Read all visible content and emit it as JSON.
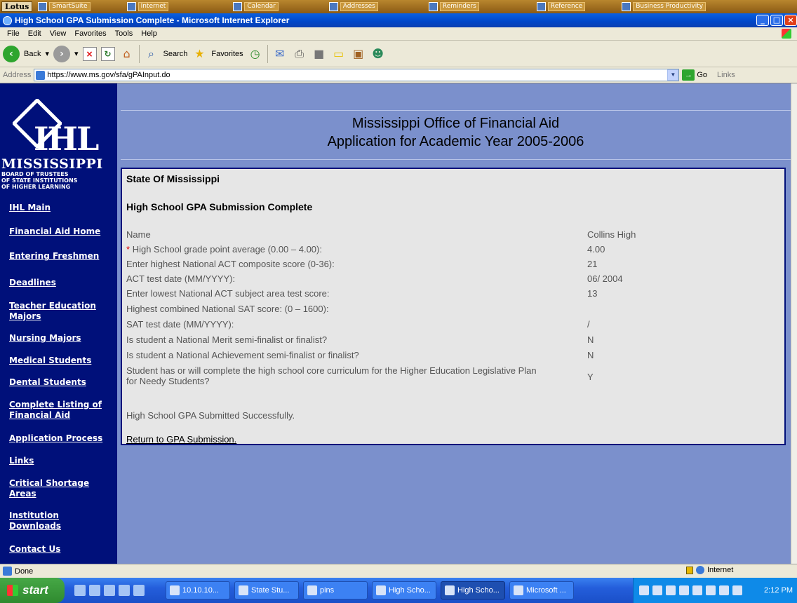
{
  "lotus": {
    "brand": "Lotus",
    "items": [
      {
        "label": "SmartSuite",
        "icon": "smartsuite-icon"
      },
      {
        "label": "Internet",
        "icon": "internet-icon"
      },
      {
        "label": "Calendar",
        "icon": "calendar-icon"
      },
      {
        "label": "Addresses",
        "icon": "addresses-icon"
      },
      {
        "label": "Reminders",
        "icon": "reminders-icon"
      },
      {
        "label": "Reference",
        "icon": "reference-icon"
      },
      {
        "label": "Business Productivity",
        "icon": "business-icon"
      }
    ]
  },
  "window": {
    "title": "High School GPA Submission Complete - Microsoft Internet Explorer"
  },
  "menu": {
    "items": [
      "File",
      "Edit",
      "View",
      "Favorites",
      "Tools",
      "Help"
    ]
  },
  "toolbar": {
    "back_label": "Back",
    "search_label": "Search",
    "favorites_label": "Favorites"
  },
  "address": {
    "label": "Address",
    "url": "https://www.ms.gov/sfa/gPAInput.do",
    "go_label": "Go",
    "links_label": "Links"
  },
  "sidebar": {
    "logo_text": "IHL",
    "logo_ms": "MISSISSIPPI",
    "logo_sub": [
      "BOARD OF TRUSTEES",
      "OF STATE INSTITUTIONS",
      "OF HIGHER LEARNING"
    ],
    "items": [
      {
        "label": "IHL Main"
      },
      {
        "label": "Financial Aid Home"
      },
      {
        "label": "Entering Freshmen"
      },
      {
        "label": "Deadlines"
      },
      {
        "label": "Teacher Education Majors"
      },
      {
        "label": "Nursing Majors"
      },
      {
        "label": "Medical Students"
      },
      {
        "label": "Dental Students"
      },
      {
        "label": "Complete Listing of Financial Aid"
      },
      {
        "label": "Application Process"
      },
      {
        "label": "Links"
      },
      {
        "label": "Critical Shortage Areas"
      },
      {
        "label": "Institution Downloads"
      },
      {
        "label": "Contact Us"
      }
    ]
  },
  "header": {
    "title": "Mississippi Office of Financial Aid",
    "subtitle": "Application for Academic Year 2005-2006"
  },
  "content": {
    "state": "State Of Mississippi",
    "section_title": "High School GPA Submission Complete",
    "rows": [
      {
        "label": "Name",
        "value": "Collins High",
        "required": false
      },
      {
        "label": "High School grade point average (0.00 – 4.00):",
        "value": "4.00",
        "required": true
      },
      {
        "label": "Enter highest National ACT composite score (0-36):",
        "value": "21",
        "required": false
      },
      {
        "label": "ACT test date (MM/YYYY):",
        "value": "06/ 2004",
        "required": false
      },
      {
        "label": "Enter lowest National ACT subject area test score:",
        "value": "13",
        "required": false
      },
      {
        "label": "Highest combined National SAT score: (0 – 1600):",
        "value": "",
        "required": false
      },
      {
        "label": "SAT test date (MM/YYYY):",
        "value": "/",
        "required": false
      },
      {
        "label": "Is student a National Merit semi-finalist or finalist?",
        "value": "N",
        "required": false
      },
      {
        "label": "Is student a National Achievement semi-finalist or finalist?",
        "value": "N",
        "required": false
      },
      {
        "label": "Student has or will complete the high school core curriculum for the Higher Education Legislative Plan for Needy Students?",
        "value": "Y",
        "required": false
      }
    ],
    "required_mark": "*",
    "success_message": "High School GPA Submitted Successfully.",
    "return_link": "Return to GPA Submission."
  },
  "status": {
    "text": "Done",
    "zone": "Internet"
  },
  "taskbar": {
    "start_label": "start",
    "tasks": [
      {
        "label": "10.10.10...",
        "active": false
      },
      {
        "label": "State Stu...",
        "active": false
      },
      {
        "label": "pins",
        "active": false
      },
      {
        "label": "High Scho...",
        "active": false
      },
      {
        "label": "High Scho...",
        "active": true
      },
      {
        "label": "Microsoft ...",
        "active": false
      }
    ],
    "clock": "2:12 PM"
  }
}
